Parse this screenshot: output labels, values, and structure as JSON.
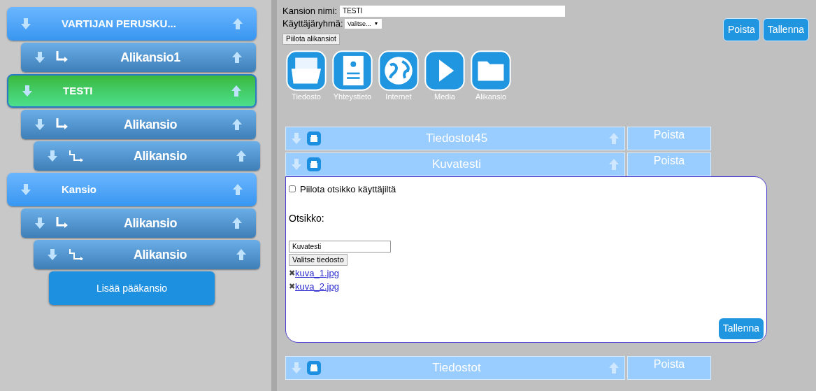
{
  "sidebar": {
    "folders": [
      {
        "label": "VARTIJAN PERUSKU...",
        "selected": false,
        "children": [
          {
            "label": "Alikansio1",
            "selected": false
          }
        ]
      },
      {
        "label": "TESTI",
        "selected": true,
        "children": [
          {
            "label": "Alikansio",
            "selected": false,
            "children": [
              {
                "label": "Alikansio",
                "selected": false
              }
            ]
          }
        ]
      },
      {
        "label": "Kansio",
        "selected": false,
        "children": [
          {
            "label": "Alikansio",
            "selected": false,
            "children": [
              {
                "label": "Alikansio",
                "selected": false
              }
            ]
          }
        ]
      }
    ],
    "add_button": "Lisää pääkansio"
  },
  "form": {
    "name_label": "Kansion nimi:",
    "name_value": "TESTI",
    "group_label": "Käyttäjäryhmä:",
    "group_value": "Valitse...",
    "group_caret": "▼",
    "hide_button": "Piilota alikansiot",
    "delete_button": "Poista",
    "save_button": "Tallenna"
  },
  "tools": [
    {
      "kind": "file",
      "label": "Tiedosto"
    },
    {
      "kind": "contact",
      "label": "Yhteystieto"
    },
    {
      "kind": "internet",
      "label": "Internet"
    },
    {
      "kind": "media",
      "label": "Media"
    },
    {
      "kind": "folder",
      "label": "Alikansio"
    }
  ],
  "items": [
    {
      "title": "Tiedostot45",
      "delete": "Poista"
    },
    {
      "title": "Kuvatesti",
      "delete": "Poista",
      "panel": {
        "hide_label": "Piilota otsikko käyttäjiltä",
        "hide_checked": false,
        "title_label": "Otsikko:",
        "title_value": "Kuvatesti",
        "choose_button": "Valitse tiedosto",
        "remove_mark": "✖",
        "files": [
          "kuva_1.jpg",
          "kuva_2.jpg"
        ],
        "save_button": "Tallenna"
      }
    },
    {
      "title": "Tiedostot",
      "delete": "Poista"
    }
  ]
}
